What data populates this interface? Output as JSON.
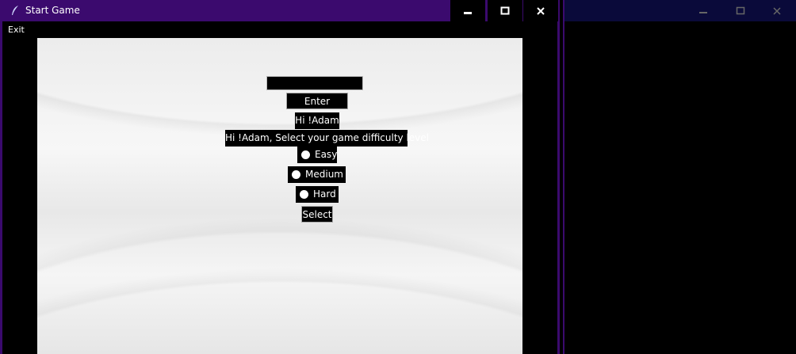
{
  "window": {
    "title": "Start Game",
    "icon": "feather-icon",
    "titlebar_color": "#3b0a6e"
  },
  "menu": {
    "exit_label": "Exit"
  },
  "form": {
    "name_value": "",
    "enter_label": "Enter",
    "greeting": "Hi !Adam",
    "difficulty_prompt": "Hi !Adam, Select your game difficulty level",
    "options": [
      {
        "label": "Easy"
      },
      {
        "label": "Medium"
      },
      {
        "label": "Hard"
      }
    ],
    "select_label": "Select"
  },
  "window2": {
    "titlebar_color": "#0a0a3a"
  }
}
